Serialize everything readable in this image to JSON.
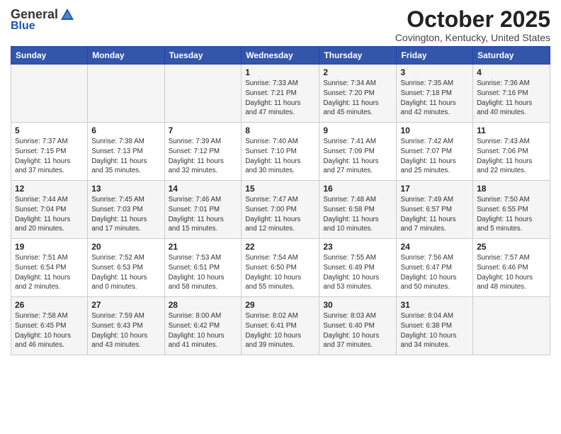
{
  "header": {
    "logo_general": "General",
    "logo_blue": "Blue",
    "month": "October 2025",
    "location": "Covington, Kentucky, United States"
  },
  "weekdays": [
    "Sunday",
    "Monday",
    "Tuesday",
    "Wednesday",
    "Thursday",
    "Friday",
    "Saturday"
  ],
  "weeks": [
    [
      {
        "day": "",
        "info": ""
      },
      {
        "day": "",
        "info": ""
      },
      {
        "day": "",
        "info": ""
      },
      {
        "day": "1",
        "info": "Sunrise: 7:33 AM\nSunset: 7:21 PM\nDaylight: 11 hours\nand 47 minutes."
      },
      {
        "day": "2",
        "info": "Sunrise: 7:34 AM\nSunset: 7:20 PM\nDaylight: 11 hours\nand 45 minutes."
      },
      {
        "day": "3",
        "info": "Sunrise: 7:35 AM\nSunset: 7:18 PM\nDaylight: 11 hours\nand 42 minutes."
      },
      {
        "day": "4",
        "info": "Sunrise: 7:36 AM\nSunset: 7:16 PM\nDaylight: 11 hours\nand 40 minutes."
      }
    ],
    [
      {
        "day": "5",
        "info": "Sunrise: 7:37 AM\nSunset: 7:15 PM\nDaylight: 11 hours\nand 37 minutes."
      },
      {
        "day": "6",
        "info": "Sunrise: 7:38 AM\nSunset: 7:13 PM\nDaylight: 11 hours\nand 35 minutes."
      },
      {
        "day": "7",
        "info": "Sunrise: 7:39 AM\nSunset: 7:12 PM\nDaylight: 11 hours\nand 32 minutes."
      },
      {
        "day": "8",
        "info": "Sunrise: 7:40 AM\nSunset: 7:10 PM\nDaylight: 11 hours\nand 30 minutes."
      },
      {
        "day": "9",
        "info": "Sunrise: 7:41 AM\nSunset: 7:09 PM\nDaylight: 11 hours\nand 27 minutes."
      },
      {
        "day": "10",
        "info": "Sunrise: 7:42 AM\nSunset: 7:07 PM\nDaylight: 11 hours\nand 25 minutes."
      },
      {
        "day": "11",
        "info": "Sunrise: 7:43 AM\nSunset: 7:06 PM\nDaylight: 11 hours\nand 22 minutes."
      }
    ],
    [
      {
        "day": "12",
        "info": "Sunrise: 7:44 AM\nSunset: 7:04 PM\nDaylight: 11 hours\nand 20 minutes."
      },
      {
        "day": "13",
        "info": "Sunrise: 7:45 AM\nSunset: 7:03 PM\nDaylight: 11 hours\nand 17 minutes."
      },
      {
        "day": "14",
        "info": "Sunrise: 7:46 AM\nSunset: 7:01 PM\nDaylight: 11 hours\nand 15 minutes."
      },
      {
        "day": "15",
        "info": "Sunrise: 7:47 AM\nSunset: 7:00 PM\nDaylight: 11 hours\nand 12 minutes."
      },
      {
        "day": "16",
        "info": "Sunrise: 7:48 AM\nSunset: 6:58 PM\nDaylight: 11 hours\nand 10 minutes."
      },
      {
        "day": "17",
        "info": "Sunrise: 7:49 AM\nSunset: 6:57 PM\nDaylight: 11 hours\nand 7 minutes."
      },
      {
        "day": "18",
        "info": "Sunrise: 7:50 AM\nSunset: 6:55 PM\nDaylight: 11 hours\nand 5 minutes."
      }
    ],
    [
      {
        "day": "19",
        "info": "Sunrise: 7:51 AM\nSunset: 6:54 PM\nDaylight: 11 hours\nand 2 minutes."
      },
      {
        "day": "20",
        "info": "Sunrise: 7:52 AM\nSunset: 6:53 PM\nDaylight: 11 hours\nand 0 minutes."
      },
      {
        "day": "21",
        "info": "Sunrise: 7:53 AM\nSunset: 6:51 PM\nDaylight: 10 hours\nand 58 minutes."
      },
      {
        "day": "22",
        "info": "Sunrise: 7:54 AM\nSunset: 6:50 PM\nDaylight: 10 hours\nand 55 minutes."
      },
      {
        "day": "23",
        "info": "Sunrise: 7:55 AM\nSunset: 6:49 PM\nDaylight: 10 hours\nand 53 minutes."
      },
      {
        "day": "24",
        "info": "Sunrise: 7:56 AM\nSunset: 6:47 PM\nDaylight: 10 hours\nand 50 minutes."
      },
      {
        "day": "25",
        "info": "Sunrise: 7:57 AM\nSunset: 6:46 PM\nDaylight: 10 hours\nand 48 minutes."
      }
    ],
    [
      {
        "day": "26",
        "info": "Sunrise: 7:58 AM\nSunset: 6:45 PM\nDaylight: 10 hours\nand 46 minutes."
      },
      {
        "day": "27",
        "info": "Sunrise: 7:59 AM\nSunset: 6:43 PM\nDaylight: 10 hours\nand 43 minutes."
      },
      {
        "day": "28",
        "info": "Sunrise: 8:00 AM\nSunset: 6:42 PM\nDaylight: 10 hours\nand 41 minutes."
      },
      {
        "day": "29",
        "info": "Sunrise: 8:02 AM\nSunset: 6:41 PM\nDaylight: 10 hours\nand 39 minutes."
      },
      {
        "day": "30",
        "info": "Sunrise: 8:03 AM\nSunset: 6:40 PM\nDaylight: 10 hours\nand 37 minutes."
      },
      {
        "day": "31",
        "info": "Sunrise: 8:04 AM\nSunset: 6:38 PM\nDaylight: 10 hours\nand 34 minutes."
      },
      {
        "day": "",
        "info": ""
      }
    ]
  ]
}
